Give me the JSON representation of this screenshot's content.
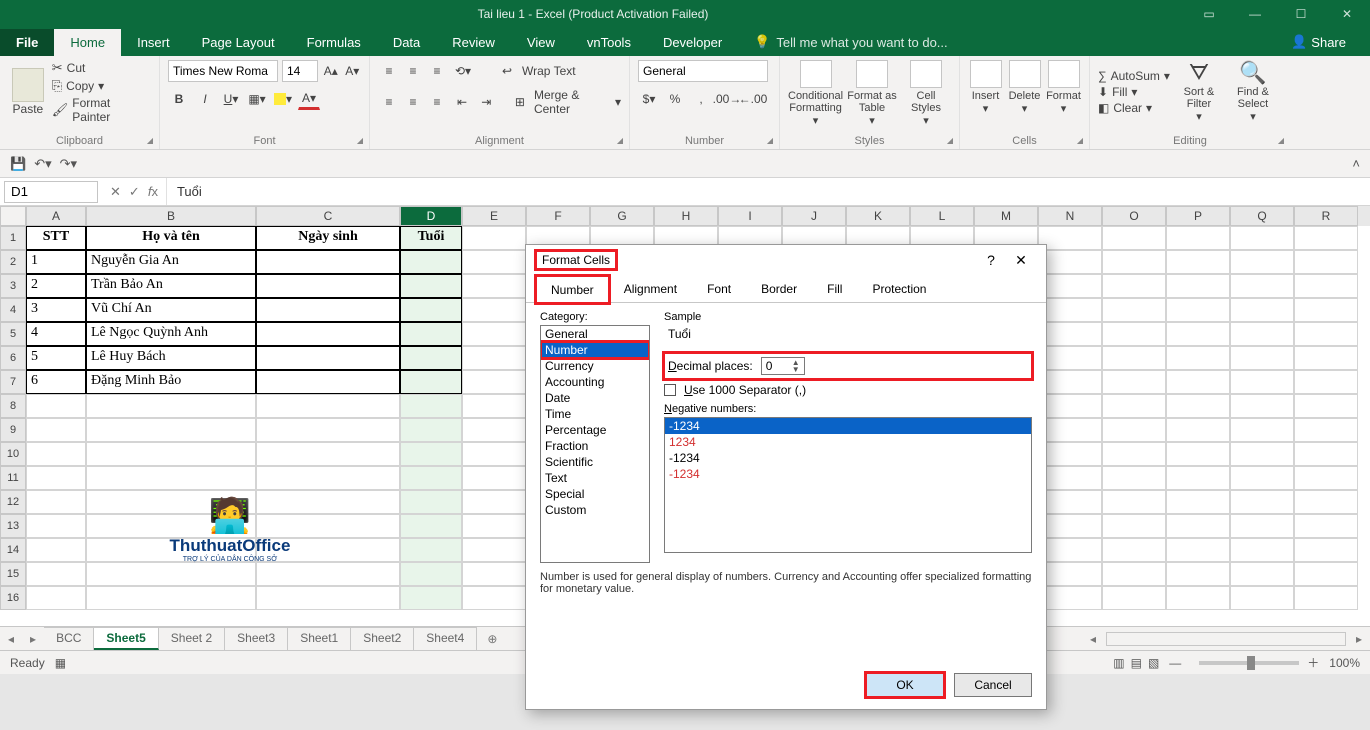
{
  "titlebar": {
    "title": "Tai lieu 1 - Excel (Product Activation Failed)"
  },
  "tabs": {
    "file": "File",
    "home": "Home",
    "insert": "Insert",
    "pagelayout": "Page Layout",
    "formulas": "Formulas",
    "data": "Data",
    "review": "Review",
    "view": "View",
    "vntools": "vnTools",
    "developer": "Developer",
    "tell": "Tell me what you want to do...",
    "share": "Share"
  },
  "ribbon": {
    "paste": "Paste",
    "cut": "Cut",
    "copy": "Copy",
    "fmtpainter": "Format Painter",
    "clipboard": "Clipboard",
    "font": "Font",
    "alignment": "Alignment",
    "number": "Number",
    "styles": "Styles",
    "cells": "Cells",
    "editing": "Editing",
    "fontname": "Times New Roma",
    "fontsize": "14",
    "wrap": "Wrap Text",
    "merge": "Merge & Center",
    "numfmt": "General",
    "condfmt": "Conditional Formatting",
    "fmtastable": "Format as Table",
    "cellstyles": "Cell Styles",
    "insert": "Insert",
    "delete": "Delete",
    "format": "Format",
    "autosum": "AutoSum",
    "fill": "Fill",
    "clear": "Clear",
    "sortfilter": "Sort & Filter",
    "findselect": "Find & Select"
  },
  "formula": {
    "namebox": "D1",
    "value": "Tuổi"
  },
  "grid": {
    "cols": [
      "A",
      "B",
      "C",
      "D",
      "E",
      "F",
      "G",
      "H",
      "I",
      "J",
      "K",
      "L",
      "M",
      "N",
      "O",
      "P",
      "Q",
      "R"
    ],
    "headers": {
      "stt": "STT",
      "hoten": "Họ và tên",
      "ngaysinh": "Ngày sinh",
      "tuoi": "Tuổi"
    },
    "rows": [
      {
        "stt": "1",
        "name": "Nguyễn Gia An"
      },
      {
        "stt": "2",
        "name": "Trần Bảo An"
      },
      {
        "stt": "3",
        "name": "Vũ Chí An"
      },
      {
        "stt": "4",
        "name": "Lê Ngọc Quỳnh Anh"
      },
      {
        "stt": "5",
        "name": "Lê Huy Bách"
      },
      {
        "stt": "6",
        "name": "Đặng Minh Bảo"
      }
    ],
    "watermark": "ThuthuatOffice"
  },
  "sheets": [
    "BCC",
    "Sheet5",
    "Sheet 2",
    "Sheet3",
    "Sheet1",
    "Sheet2",
    "Sheet4"
  ],
  "active_sheet": "Sheet5",
  "status": {
    "ready": "Ready",
    "zoom": "100%"
  },
  "dialog": {
    "title": "Format Cells",
    "tabs": [
      "Number",
      "Alignment",
      "Font",
      "Border",
      "Fill",
      "Protection"
    ],
    "category_label": "Category:",
    "categories": [
      "General",
      "Number",
      "Currency",
      "Accounting",
      "Date",
      "Time",
      "Percentage",
      "Fraction",
      "Scientific",
      "Text",
      "Special",
      "Custom"
    ],
    "selected_category": "Number",
    "sample_label": "Sample",
    "sample_value": "Tuổi",
    "decimal_label": "Decimal places:",
    "decimal_value": "0",
    "thousand_label": "Use 1000 Separator (,)",
    "negative_label": "Negative numbers:",
    "negatives": [
      {
        "text": "-1234",
        "color": "#fff",
        "selected": true
      },
      {
        "text": "1234",
        "color": "#d32f2f"
      },
      {
        "text": "-1234",
        "color": "#000"
      },
      {
        "text": "-1234",
        "color": "#d32f2f"
      }
    ],
    "description": "Number is used for general display of numbers.  Currency and Accounting offer specialized formatting for monetary value.",
    "ok": "OK",
    "cancel": "Cancel"
  }
}
